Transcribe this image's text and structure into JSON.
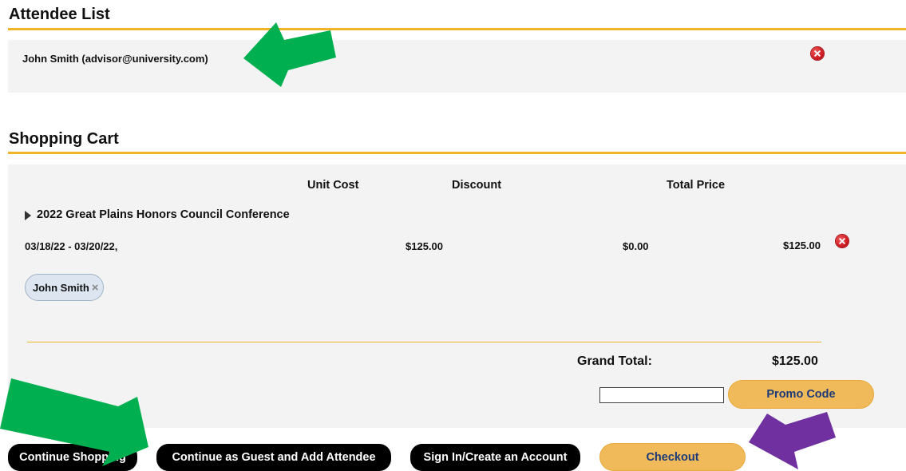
{
  "attendees": {
    "title": "Attendee List",
    "items": [
      {
        "label": "John Smith (advisor@university.com)"
      }
    ]
  },
  "cart": {
    "title": "Shopping Cart",
    "columns": {
      "unit_cost": "Unit Cost",
      "discount": "Discount",
      "total_price": "Total Price"
    },
    "items": [
      {
        "name": "2022 Great Plains Honors Council Conference",
        "dates": "03/18/22 - 03/20/22,",
        "unit_cost": "$125.00",
        "discount": "$0.00",
        "total_price": "$125.00",
        "attendee_tag": "John Smith"
      }
    ],
    "grand_total_label": "Grand Total:",
    "grand_total_value": "$125.00",
    "promo": {
      "input_value": "",
      "button_label": "Promo Code"
    }
  },
  "actions": {
    "continue_shopping": "Continue Shopping",
    "continue_guest": "Continue as Guest and Add Attendee",
    "sign_in": "Sign In/Create an Account",
    "checkout": "Checkout"
  },
  "colors": {
    "accent_gold": "#f0b429",
    "button_gold": "#f0b95a",
    "annotation_green": "#00b050",
    "annotation_purple": "#7030a0",
    "remove_red": "#d9141f"
  }
}
